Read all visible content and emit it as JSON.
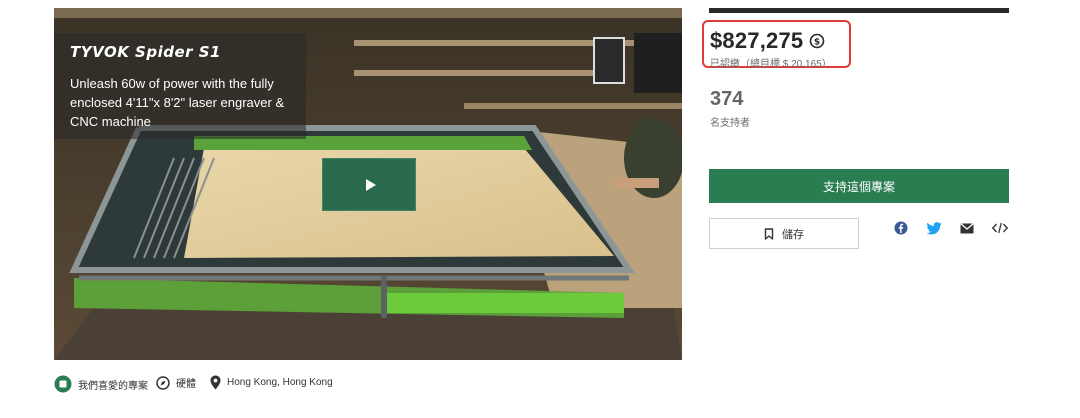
{
  "video": {
    "brand": "TYVOK Spider S1",
    "tagline": "Unleash 60w of power with the fully enclosed 4'11\"x 8'2\" laser engraver & CNC machine"
  },
  "funding": {
    "amount": "$827,275",
    "goal_text": "已認繳（總目標 $ 20,165）",
    "backers_count": "374",
    "backers_label": "名支持者"
  },
  "actions": {
    "back_label": "支持這個專案",
    "save_label": "儲存"
  },
  "tags": [
    {
      "label": "我們喜愛的專案",
      "icon": "kickstarter-badge-icon"
    },
    {
      "label": "硬體",
      "icon": "compass-icon"
    },
    {
      "label": "Hong Kong, Hong Kong",
      "icon": "location-pin-icon"
    }
  ],
  "share_icons": [
    "facebook-icon",
    "twitter-icon",
    "email-icon",
    "embed-icon"
  ],
  "colors": {
    "accent_green": "#2a7c51",
    "highlight_red": "#e03b3b",
    "play_green": "#2a6a4d"
  }
}
